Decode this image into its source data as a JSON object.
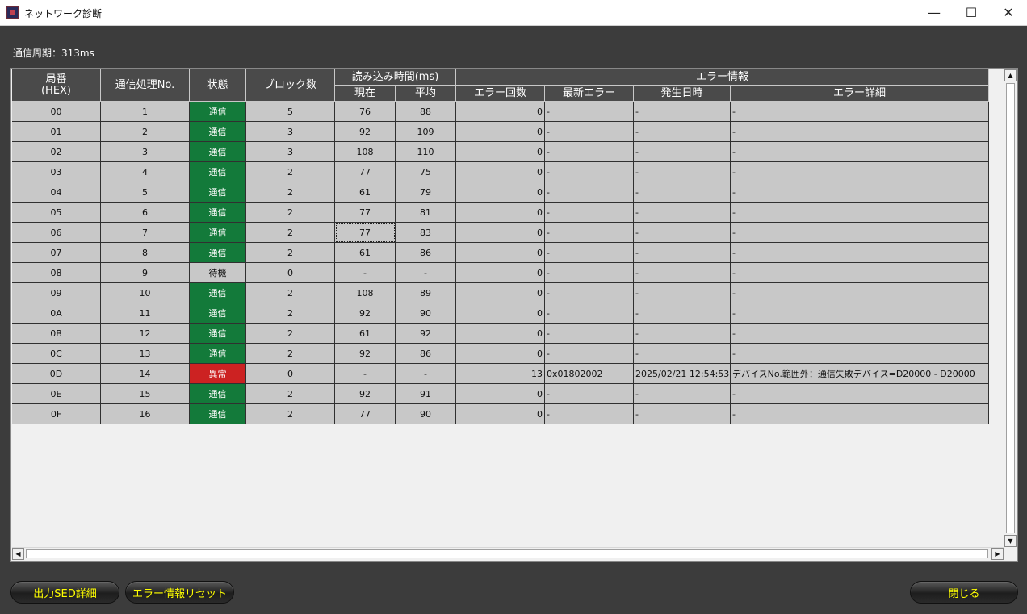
{
  "window": {
    "title": "ネットワーク診断",
    "minimize": "—",
    "maximize": "☐",
    "close": "✕"
  },
  "cycle_label": "通信周期：313ms",
  "headers": {
    "station": "局番\n(HEX)",
    "proc_no": "通信処理No.",
    "status": "状態",
    "blocks": "ブロック数",
    "read_time": "読み込み時間(ms)",
    "current": "現在",
    "average": "平均",
    "error_info": "エラー情報",
    "error_count": "エラー回数",
    "latest_error": "最新エラー",
    "occurred": "発生日時",
    "error_detail": "エラー詳細"
  },
  "rows": [
    {
      "station": "00",
      "no": "1",
      "status": "通信",
      "state": "ok",
      "blocks": "5",
      "cur": "76",
      "avg": "88",
      "errs": "0",
      "latest": "-",
      "date": "-",
      "detail": "-"
    },
    {
      "station": "01",
      "no": "2",
      "status": "通信",
      "state": "ok",
      "blocks": "3",
      "cur": "92",
      "avg": "109",
      "errs": "0",
      "latest": "-",
      "date": "-",
      "detail": "-"
    },
    {
      "station": "02",
      "no": "3",
      "status": "通信",
      "state": "ok",
      "blocks": "3",
      "cur": "108",
      "avg": "110",
      "errs": "0",
      "latest": "-",
      "date": "-",
      "detail": "-"
    },
    {
      "station": "03",
      "no": "4",
      "status": "通信",
      "state": "ok",
      "blocks": "2",
      "cur": "77",
      "avg": "75",
      "errs": "0",
      "latest": "-",
      "date": "-",
      "detail": "-"
    },
    {
      "station": "04",
      "no": "5",
      "status": "通信",
      "state": "ok",
      "blocks": "2",
      "cur": "61",
      "avg": "79",
      "errs": "0",
      "latest": "-",
      "date": "-",
      "detail": "-"
    },
    {
      "station": "05",
      "no": "6",
      "status": "通信",
      "state": "ok",
      "blocks": "2",
      "cur": "77",
      "avg": "81",
      "errs": "0",
      "latest": "-",
      "date": "-",
      "detail": "-"
    },
    {
      "station": "06",
      "no": "7",
      "status": "通信",
      "state": "ok",
      "blocks": "2",
      "cur": "77",
      "avg": "83",
      "errs": "0",
      "latest": "-",
      "date": "-",
      "detail": "-"
    },
    {
      "station": "07",
      "no": "8",
      "status": "通信",
      "state": "ok",
      "blocks": "2",
      "cur": "61",
      "avg": "86",
      "errs": "0",
      "latest": "-",
      "date": "-",
      "detail": "-"
    },
    {
      "station": "08",
      "no": "9",
      "status": "待機",
      "state": "wait",
      "blocks": "0",
      "cur": "-",
      "avg": "-",
      "errs": "0",
      "latest": "-",
      "date": "-",
      "detail": "-"
    },
    {
      "station": "09",
      "no": "10",
      "status": "通信",
      "state": "ok",
      "blocks": "2",
      "cur": "108",
      "avg": "89",
      "errs": "0",
      "latest": "-",
      "date": "-",
      "detail": "-"
    },
    {
      "station": "0A",
      "no": "11",
      "status": "通信",
      "state": "ok",
      "blocks": "2",
      "cur": "92",
      "avg": "90",
      "errs": "0",
      "latest": "-",
      "date": "-",
      "detail": "-"
    },
    {
      "station": "0B",
      "no": "12",
      "status": "通信",
      "state": "ok",
      "blocks": "2",
      "cur": "61",
      "avg": "92",
      "errs": "0",
      "latest": "-",
      "date": "-",
      "detail": "-"
    },
    {
      "station": "0C",
      "no": "13",
      "status": "通信",
      "state": "ok",
      "blocks": "2",
      "cur": "92",
      "avg": "86",
      "errs": "0",
      "latest": "-",
      "date": "-",
      "detail": "-"
    },
    {
      "station": "0D",
      "no": "14",
      "status": "異常",
      "state": "err",
      "blocks": "0",
      "cur": "-",
      "avg": "-",
      "errs": "13",
      "latest": "0x01802002",
      "date": "2025/02/21 12:54:53",
      "detail": "デバイスNo.範囲外：通信失敗デバイス=D20000 - D20000"
    },
    {
      "station": "0E",
      "no": "15",
      "status": "通信",
      "state": "ok",
      "blocks": "2",
      "cur": "92",
      "avg": "91",
      "errs": "0",
      "latest": "-",
      "date": "-",
      "detail": "-"
    },
    {
      "station": "0F",
      "no": "16",
      "status": "通信",
      "state": "ok",
      "blocks": "2",
      "cur": "77",
      "avg": "90",
      "errs": "0",
      "latest": "-",
      "date": "-",
      "detail": "-"
    }
  ],
  "buttons": {
    "sed_detail": "出力SED詳細",
    "error_reset": "エラー情報リセット",
    "close": "閉じる"
  },
  "colors": {
    "status_ok": "#137a3a",
    "status_err": "#cc2222",
    "button_text": "#ffff00"
  }
}
